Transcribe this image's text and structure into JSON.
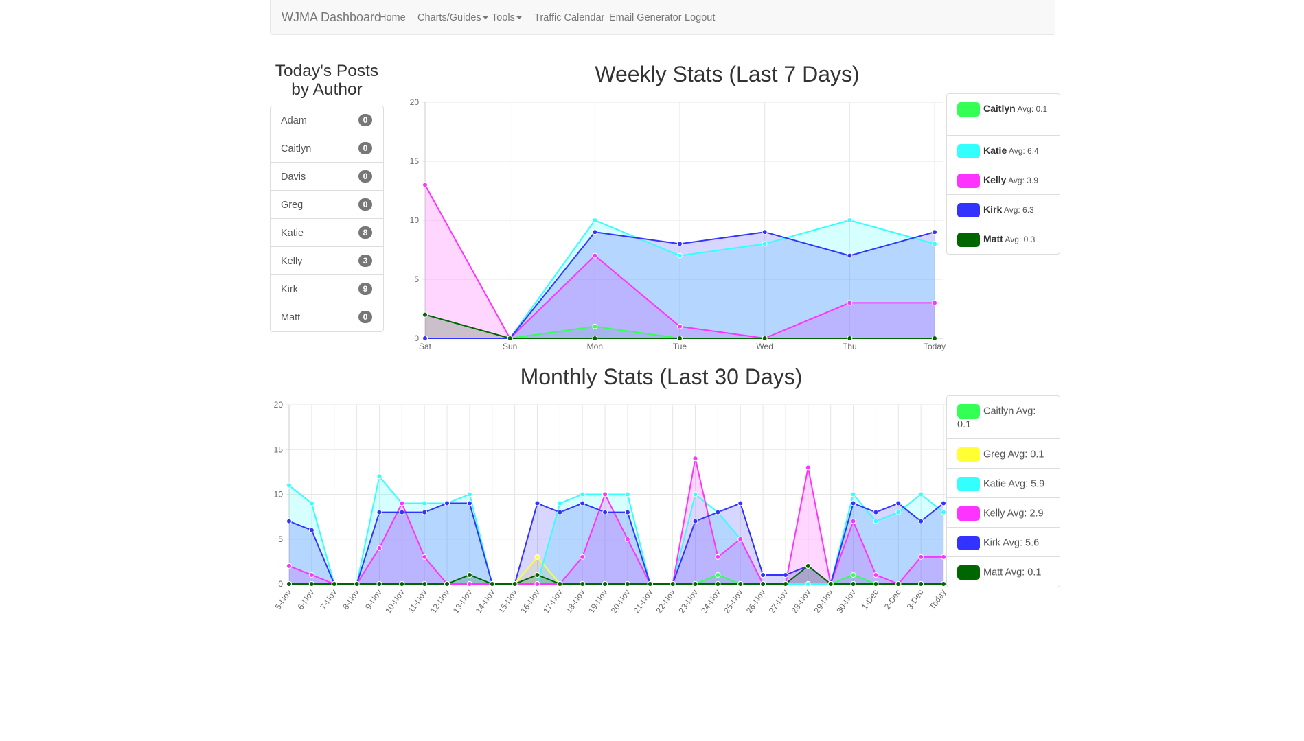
{
  "navbar": {
    "brand": "WJMA Dashboard",
    "items": [
      {
        "label": "Home",
        "dropdown": false
      },
      {
        "label": "Charts/Guides",
        "dropdown": true
      },
      {
        "label": "Tools",
        "dropdown": true
      },
      {
        "label": "Traffic Calendar",
        "dropdown": false
      },
      {
        "label": "Email Generator",
        "dropdown": false
      },
      {
        "label": "Logout",
        "dropdown": false
      }
    ]
  },
  "authors": {
    "title_line1": "Today's Posts",
    "title_line2": "by Author",
    "items": [
      {
        "name": "Adam",
        "count": "0"
      },
      {
        "name": "Caitlyn",
        "count": "0"
      },
      {
        "name": "Davis",
        "count": "0"
      },
      {
        "name": "Greg",
        "count": "0"
      },
      {
        "name": "Katie",
        "count": "8"
      },
      {
        "name": "Kelly",
        "count": "3"
      },
      {
        "name": "Kirk",
        "count": "9"
      },
      {
        "name": "Matt",
        "count": "0"
      }
    ]
  },
  "weekly": {
    "title": "Weekly Stats (Last 7 Days)",
    "legend": [
      {
        "name": "Caitlyn",
        "avg_label": "Avg:",
        "avg_value": "0.1",
        "color": "#33ff55"
      },
      {
        "name": "Katie",
        "avg_label": "Avg:",
        "avg_value": "6.4",
        "color": "#33ffff"
      },
      {
        "name": "Kelly",
        "avg_label": "Avg:",
        "avg_value": "3.9",
        "color": "#ff33ff"
      },
      {
        "name": "Kirk",
        "avg_label": "Avg:",
        "avg_value": "6.3",
        "color": "#3333ff"
      },
      {
        "name": "Matt",
        "avg_label": "Avg:",
        "avg_value": "0.3",
        "color": "#006600"
      }
    ]
  },
  "monthly": {
    "title": "Monthly Stats (Last 30 Days)",
    "legend": [
      {
        "name": "Caitlyn",
        "avg_label": "Avg:",
        "avg_value": "0.1",
        "color": "#33ff55"
      },
      {
        "name": "Greg",
        "avg_label": "Avg:",
        "avg_value": "0.1",
        "color": "#ffff33"
      },
      {
        "name": "Katie",
        "avg_label": "Avg:",
        "avg_value": "5.9",
        "color": "#33ffff"
      },
      {
        "name": "Kelly",
        "avg_label": "Avg:",
        "avg_value": "2.9",
        "color": "#ff33ff"
      },
      {
        "name": "Kirk",
        "avg_label": "Avg:",
        "avg_value": "5.6",
        "color": "#3333ff"
      },
      {
        "name": "Matt",
        "avg_label": "Avg:",
        "avg_value": "0.1",
        "color": "#006600"
      }
    ]
  },
  "chart_data": [
    {
      "type": "area",
      "title": "Weekly Stats (Last 7 Days)",
      "xlabel": "",
      "ylabel": "",
      "ylim": [
        0,
        20
      ],
      "yticks": [
        0,
        5,
        10,
        15,
        20
      ],
      "grid": true,
      "legend": "right",
      "categories": [
        "Sat",
        "Sun",
        "Mon",
        "Tue",
        "Wed",
        "Thu",
        "Today"
      ],
      "series": [
        {
          "name": "Caitlyn",
          "color": "#33ff55",
          "values": [
            0,
            0,
            1,
            0,
            0,
            0,
            0
          ]
        },
        {
          "name": "Katie",
          "color": "#33ffff",
          "values": [
            0,
            0,
            10,
            7,
            8,
            10,
            8
          ]
        },
        {
          "name": "Kelly",
          "color": "#ff33ff",
          "values": [
            13,
            0,
            7,
            1,
            0,
            3,
            3
          ]
        },
        {
          "name": "Kirk",
          "color": "#3333ff",
          "values": [
            0,
            0,
            9,
            8,
            9,
            7,
            9
          ]
        },
        {
          "name": "Matt",
          "color": "#006600",
          "values": [
            2,
            0,
            0,
            0,
            0,
            0,
            0
          ]
        }
      ]
    },
    {
      "type": "area",
      "title": "Monthly Stats (Last 30 Days)",
      "xlabel": "",
      "ylabel": "",
      "ylim": [
        0,
        20
      ],
      "yticks": [
        0,
        5,
        10,
        15,
        20
      ],
      "grid": true,
      "legend": "right",
      "categories": [
        "5-Nov",
        "6-Nov",
        "7-Nov",
        "8-Nov",
        "9-Nov",
        "10-Nov",
        "11-Nov",
        "12-Nov",
        "13-Nov",
        "14-Nov",
        "15-Nov",
        "16-Nov",
        "17-Nov",
        "18-Nov",
        "19-Nov",
        "20-Nov",
        "21-Nov",
        "22-Nov",
        "23-Nov",
        "24-Nov",
        "25-Nov",
        "26-Nov",
        "27-Nov",
        "28-Nov",
        "29-Nov",
        "30-Nov",
        "1-Dec",
        "2-Dec",
        "3-Dec",
        "Today"
      ],
      "series": [
        {
          "name": "Caitlyn",
          "color": "#33ff55",
          "values": [
            0,
            0,
            0,
            0,
            0,
            0,
            0,
            0,
            0,
            0,
            0,
            0,
            0,
            0,
            0,
            0,
            0,
            0,
            0,
            1,
            0,
            0,
            0,
            0,
            0,
            1,
            0,
            0,
            0,
            0
          ]
        },
        {
          "name": "Greg",
          "color": "#ffff33",
          "values": [
            0,
            0,
            0,
            0,
            0,
            0,
            0,
            0,
            0,
            0,
            0,
            3,
            0,
            0,
            0,
            0,
            0,
            0,
            0,
            0,
            0,
            0,
            0,
            0,
            0,
            0,
            0,
            0,
            0,
            0
          ]
        },
        {
          "name": "Katie",
          "color": "#33ffff",
          "values": [
            11,
            9,
            0,
            0,
            12,
            9,
            9,
            9,
            10,
            0,
            0,
            0,
            9,
            10,
            10,
            10,
            0,
            0,
            10,
            8,
            5,
            0,
            0,
            0,
            0,
            10,
            7,
            8,
            10,
            8
          ]
        },
        {
          "name": "Kelly",
          "color": "#ff33ff",
          "values": [
            2,
            1,
            0,
            0,
            4,
            9,
            3,
            0,
            0,
            0,
            0,
            0,
            0,
            3,
            10,
            5,
            0,
            0,
            14,
            3,
            5,
            0,
            0,
            13,
            0,
            7,
            1,
            0,
            3,
            3
          ]
        },
        {
          "name": "Kirk",
          "color": "#3333ff",
          "values": [
            7,
            6,
            0,
            0,
            8,
            8,
            8,
            9,
            9,
            0,
            0,
            9,
            8,
            9,
            8,
            8,
            0,
            0,
            7,
            8,
            9,
            1,
            1,
            2,
            0,
            9,
            8,
            9,
            7,
            9
          ]
        },
        {
          "name": "Matt",
          "color": "#006600",
          "values": [
            0,
            0,
            0,
            0,
            0,
            0,
            0,
            0,
            1,
            0,
            0,
            1,
            0,
            0,
            0,
            0,
            0,
            0,
            0,
            0,
            0,
            0,
            0,
            2,
            0,
            0,
            0,
            0,
            0,
            0
          ]
        }
      ]
    }
  ]
}
